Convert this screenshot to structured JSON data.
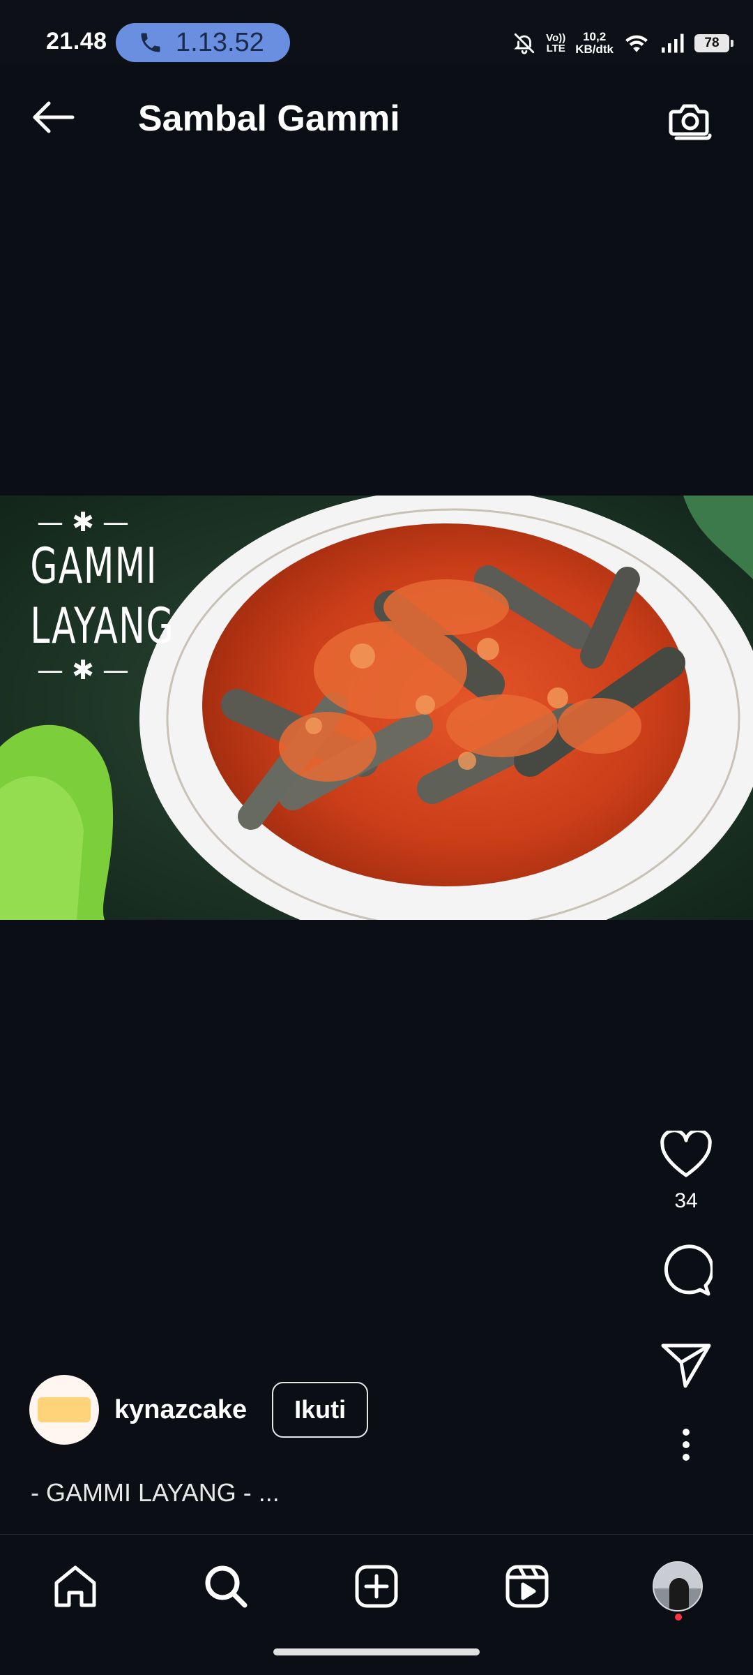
{
  "status_bar": {
    "time": "21.48",
    "call_duration": "1.13.52",
    "volte_line1": "Vo))",
    "volte_line2": "LTE",
    "net_speed_value": "10,2",
    "net_speed_unit": "KB/dtk",
    "battery": "78"
  },
  "header": {
    "title": "Sambal Gammi",
    "back_icon": "arrow-left-icon",
    "camera_icon": "camera-icon"
  },
  "media": {
    "overlay_line1": "GAMMI",
    "overlay_line2": "LAYANG",
    "overlay_deco": "— ✱ —"
  },
  "actions": {
    "like_icon": "heart-icon",
    "like_count": "34",
    "comment_icon": "comment-icon",
    "share_icon": "send-icon",
    "more_icon": "more-vertical-icon"
  },
  "post": {
    "username": "kynazcake",
    "follow_label": "Ikuti",
    "caption": "- GAMMI LAYANG - ..."
  },
  "bottom_nav": {
    "items": [
      "home-icon",
      "search-icon",
      "create-icon",
      "reels-icon",
      "profile-avatar"
    ]
  },
  "colors": {
    "background": "#0b0e14",
    "call_pill": "#6a8fe0",
    "notification_dot": "#ff3040"
  }
}
